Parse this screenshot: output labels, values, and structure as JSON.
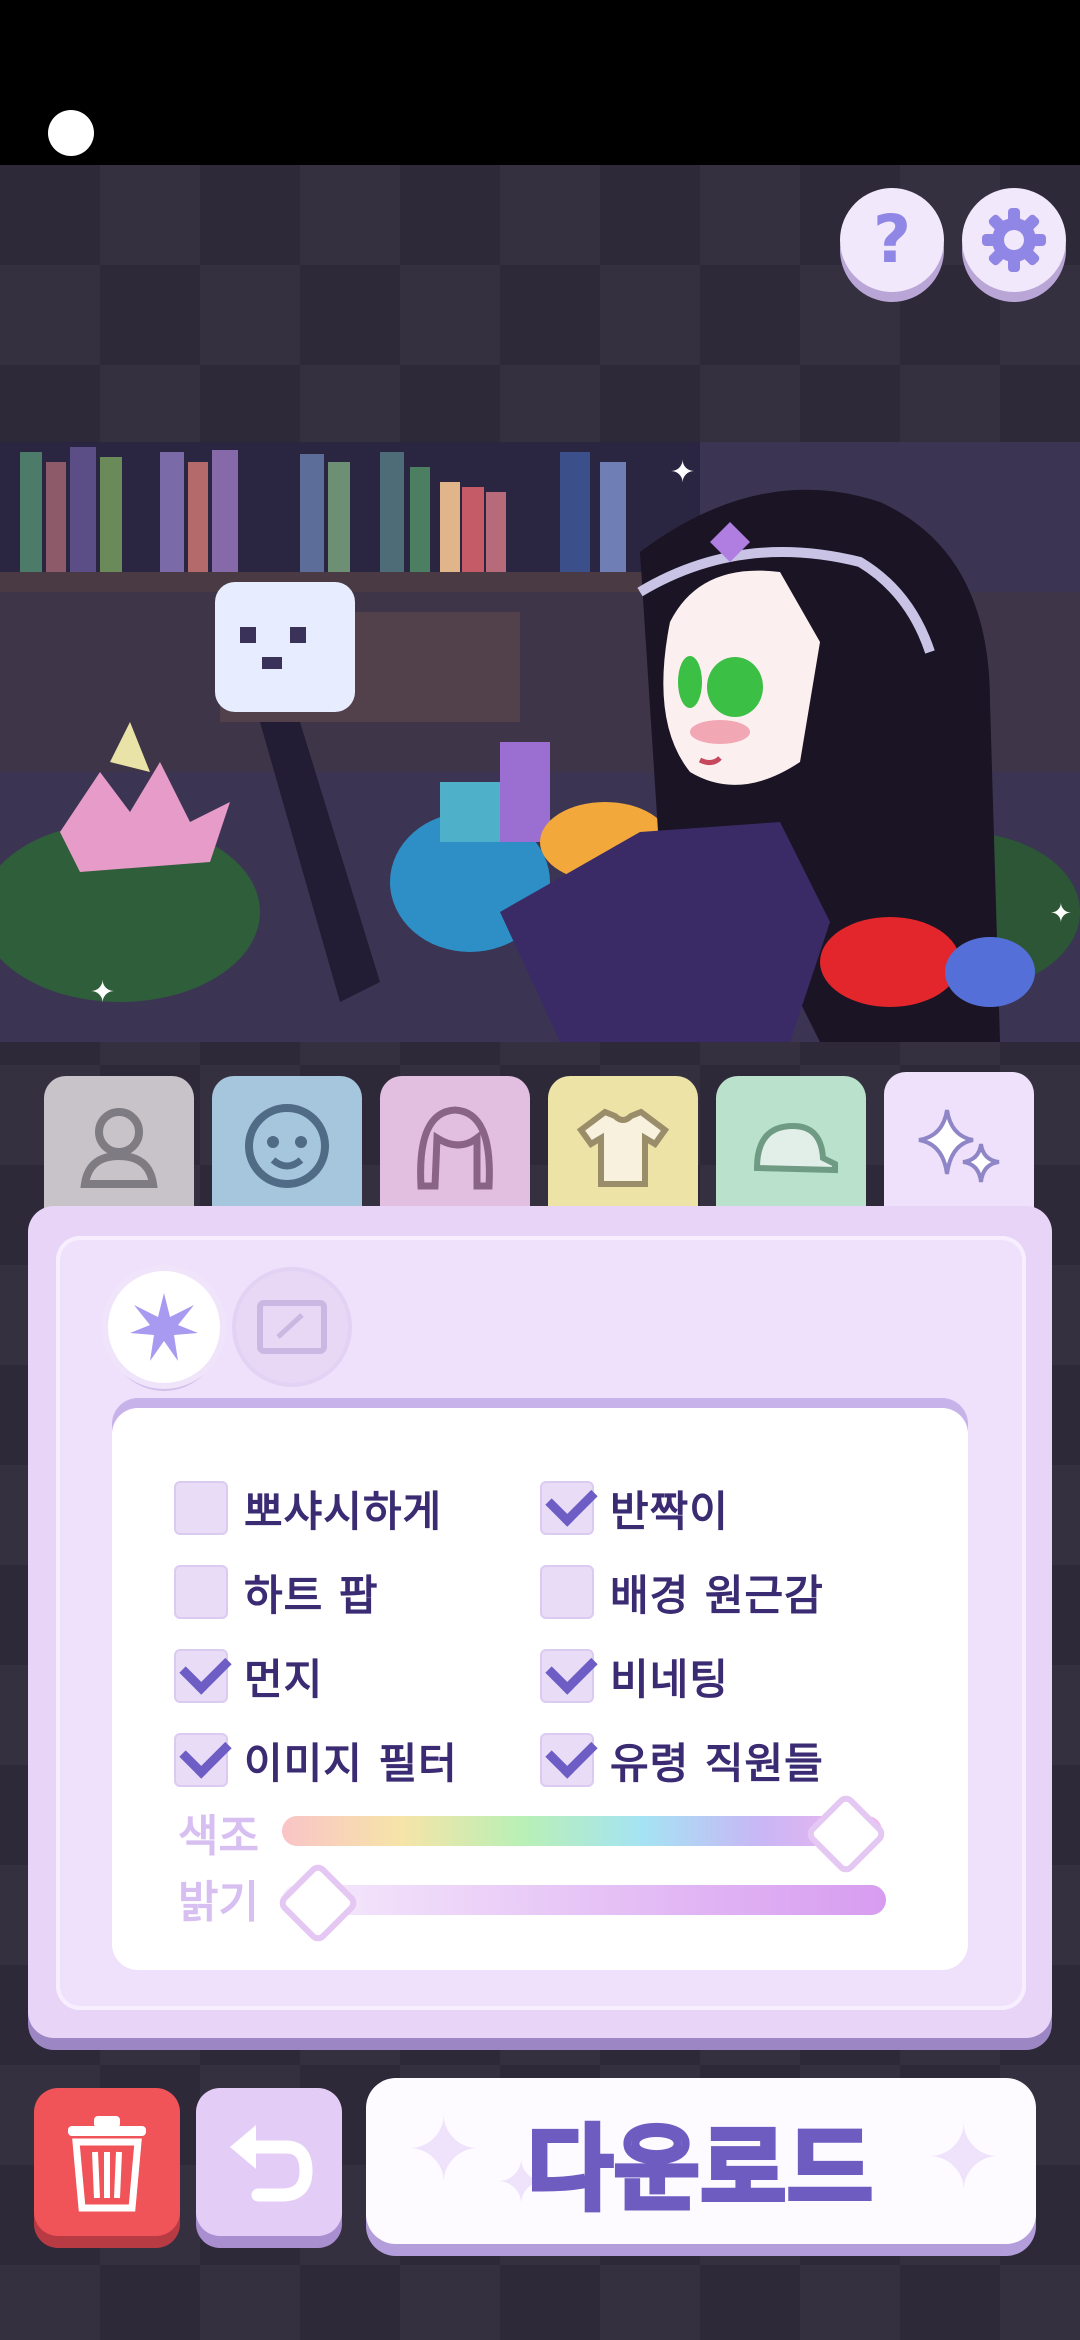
{
  "header": {
    "help_symbol": "?"
  },
  "icons": {
    "help": "question-icon",
    "settings": "gear-icon",
    "tabs": [
      "body-icon",
      "face-icon",
      "hair-icon",
      "shirt-icon",
      "hat-icon",
      "sparkle-icon"
    ],
    "modes": [
      "star-effects-icon",
      "frame-icon"
    ],
    "trash": "trash-icon",
    "undo": "undo-icon"
  },
  "tabs": [
    {
      "color": "#c8c3c9",
      "selected": false
    },
    {
      "color": "#a6c6dd",
      "selected": false
    },
    {
      "color": "#e2bfe0",
      "selected": false
    },
    {
      "color": "#ede3a7",
      "selected": false
    },
    {
      "color": "#b9e1cc",
      "selected": false
    },
    {
      "color": "#efe1fb",
      "selected": true
    }
  ],
  "options": [
    {
      "label": "뽀샤시하게",
      "checked": false
    },
    {
      "label": "반짝이",
      "checked": true
    },
    {
      "label": "하트 팝",
      "checked": false
    },
    {
      "label": "배경 원근감",
      "checked": false
    },
    {
      "label": "먼지",
      "checked": true
    },
    {
      "label": "비네팅",
      "checked": true
    },
    {
      "label": "이미지 필터",
      "checked": true
    },
    {
      "label": "유령 직원들",
      "checked": true
    }
  ],
  "sliders": {
    "hue": {
      "label": "색조",
      "value": 0.93
    },
    "brightness": {
      "label": "밝기",
      "value": 0.05
    }
  },
  "actions": {
    "download_label": "다운로드"
  },
  "colors": {
    "accent": "#6d5dc4",
    "trash": "#f05358",
    "panel": "#e7d4f7"
  }
}
